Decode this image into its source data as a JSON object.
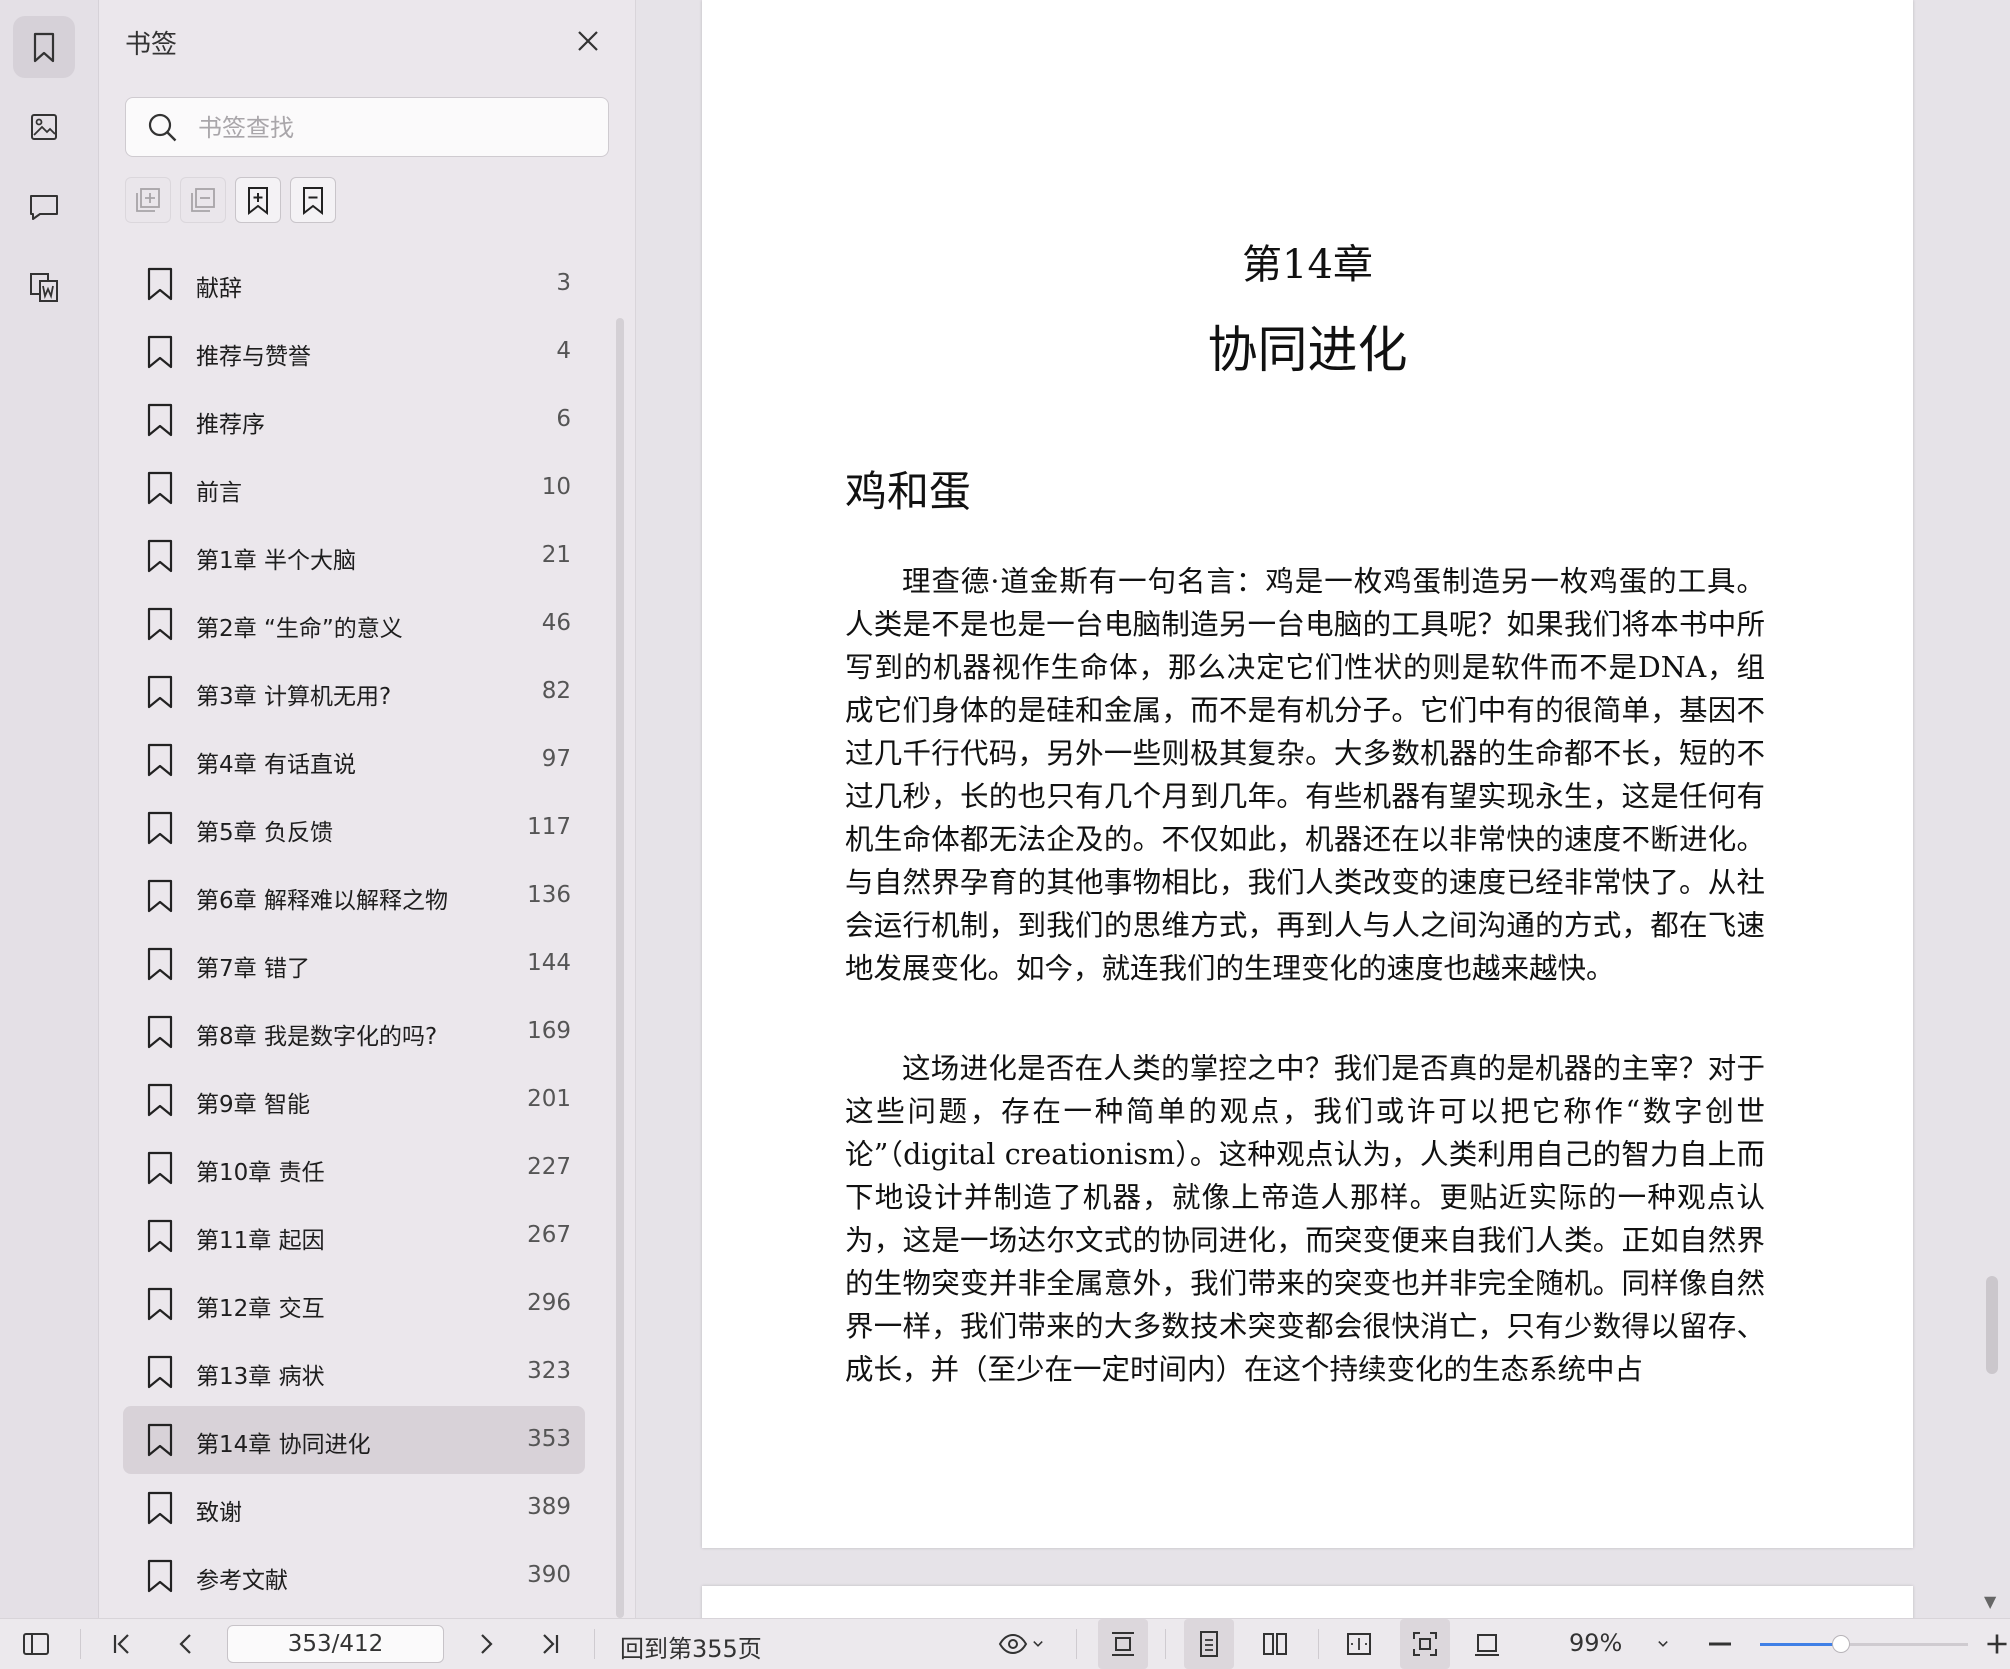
{
  "rail": {
    "items": [
      {
        "name": "bookmark-icon",
        "active": true
      },
      {
        "name": "thumbnail-icon",
        "active": false
      },
      {
        "name": "comment-icon",
        "active": false
      },
      {
        "name": "document-convert-icon",
        "active": false
      }
    ]
  },
  "panel": {
    "title": "书签",
    "search_placeholder": "书签查找",
    "toolbar": [
      {
        "name": "expand-all-icon",
        "enabled": false
      },
      {
        "name": "collapse-all-icon",
        "enabled": false
      },
      {
        "name": "add-bookmark-icon",
        "enabled": true
      },
      {
        "name": "remove-bookmark-icon",
        "enabled": true
      }
    ],
    "bookmarks": [
      {
        "label": "献辞",
        "page": "3"
      },
      {
        "label": "推荐与赞誉",
        "page": "4"
      },
      {
        "label": "推荐序",
        "page": "6"
      },
      {
        "label": "前言",
        "page": "10"
      },
      {
        "label": "第1章 半个大脑",
        "page": "21"
      },
      {
        "label": "第2章 “生命”的意义",
        "page": "46"
      },
      {
        "label": "第3章 计算机无用?",
        "page": "82"
      },
      {
        "label": "第4章 有话直说",
        "page": "97"
      },
      {
        "label": "第5章 负反馈",
        "page": "117"
      },
      {
        "label": "第6章 解释难以解释之物",
        "page": "136"
      },
      {
        "label": "第7章 错了",
        "page": "144"
      },
      {
        "label": "第8章 我是数字化的吗?",
        "page": "169"
      },
      {
        "label": "第9章 智能",
        "page": "201"
      },
      {
        "label": "第10章 责任",
        "page": "227"
      },
      {
        "label": "第11章 起因",
        "page": "267"
      },
      {
        "label": "第12章 交互",
        "page": "296"
      },
      {
        "label": "第13章 病状",
        "page": "323"
      },
      {
        "label": "第14章 协同进化",
        "page": "353",
        "selected": true
      },
      {
        "label": "致谢",
        "page": "389"
      },
      {
        "label": "参考文献",
        "page": "390"
      }
    ]
  },
  "document": {
    "chapter_number": "第14章",
    "chapter_title": "协同进化",
    "section_title": "鸡和蛋",
    "paragraphs": [
      "理查德·道金斯有一句名言：鸡是一枚鸡蛋制造另一枚鸡蛋的工具。人类是不是也是一台电脑制造另一台电脑的工具呢？如果我们将本书中所写到的机器视作生命体，那么决定它们性状的则是软件而不是DNA，组成它们身体的是硅和金属，而不是有机分子。它们中有的很简单，基因不过几千行代码，另外一些则极其复杂。大多数机器的生命都不长，短的不过几秒，长的也只有几个月到几年。有些机器有望实现永生，这是任何有机生命体都无法企及的。不仅如此，机器还在以非常快的速度不断进化。与自然界孕育的其他事物相比，我们人类改变的速度已经非常快了。从社会运行机制，到我们的思维方式，再到人与人之间沟通的方式，都在飞速地发展变化。如今，就连我们的生理变化的速度也越来越快。",
      "这场进化是否在人类的掌控之中？我们是否真的是机器的主宰？对于这些问题，存在一种简单的观点，我们或许可以把它称作“数字创世论”（digital creationism）。这种观点认为，人类利用自己的智力自上而下地设计并制造了机器，就像上帝造人那样。更贴近实际的一种观点认为，这是一场达尔文式的协同进化，而突变便来自我们人类。正如自然界的生物突变并非全属意外，我们带来的突变也并非完全随机。同样像自然界一样，我们带来的大多数技术突变都会很快消亡，只有少数得以留存、成长，并（至少在一定时间内）在这个持续变化的生态系统中占"
    ]
  },
  "bottombar": {
    "page_indicator": "353/412",
    "goto_label": "回到第355页",
    "zoom_label": "99%",
    "zoom_fraction": 0.39,
    "accent_color": "#3f7fe6"
  }
}
